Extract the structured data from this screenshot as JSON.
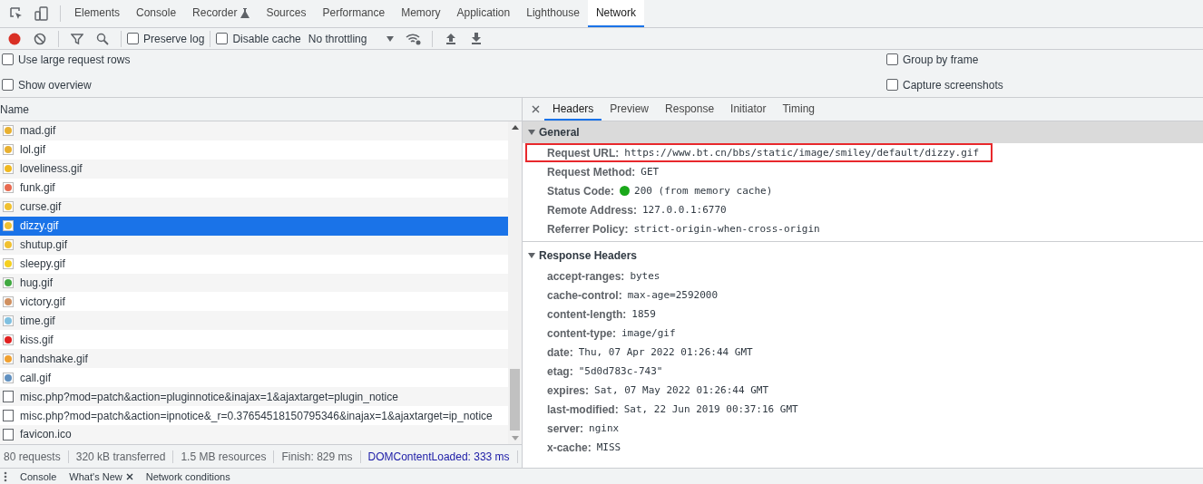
{
  "main_tabs": [
    {
      "label": "Elements",
      "selected": false
    },
    {
      "label": "Console",
      "selected": false
    },
    {
      "label": "Recorder",
      "selected": false,
      "kind": "experimental"
    },
    {
      "label": "Sources",
      "selected": false
    },
    {
      "label": "Performance",
      "selected": false
    },
    {
      "label": "Memory",
      "selected": false
    },
    {
      "label": "Application",
      "selected": false
    },
    {
      "label": "Lighthouse",
      "selected": false
    },
    {
      "label": "Network",
      "selected": true
    }
  ],
  "toolbar": {
    "recording": true,
    "preserve_log": {
      "label": "Preserve log",
      "checked": false
    },
    "disable_cache": {
      "label": "Disable cache",
      "checked": false
    },
    "throttling": "No throttling"
  },
  "settings_left": [
    {
      "label": "Use large request rows",
      "checked": false
    },
    {
      "label": "Show overview",
      "checked": false
    }
  ],
  "settings_right": [
    {
      "label": "Group by frame",
      "checked": false
    },
    {
      "label": "Capture screenshots",
      "checked": false
    }
  ],
  "requests": {
    "column": "Name",
    "rows": [
      {
        "name": "mad.gif",
        "kind": "image",
        "color": "#e8b030",
        "selected": false
      },
      {
        "name": "lol.gif",
        "kind": "image",
        "color": "#e8b030",
        "selected": false
      },
      {
        "name": "loveliness.gif",
        "kind": "image",
        "color": "#f0b820",
        "selected": false
      },
      {
        "name": "funk.gif",
        "kind": "image",
        "color": "#e86a50",
        "selected": false
      },
      {
        "name": "curse.gif",
        "kind": "image",
        "color": "#f0c030",
        "selected": false
      },
      {
        "name": "dizzy.gif",
        "kind": "image",
        "color": "#f0c030",
        "selected": true
      },
      {
        "name": "shutup.gif",
        "kind": "image",
        "color": "#f0c030",
        "selected": false
      },
      {
        "name": "sleepy.gif",
        "kind": "image",
        "color": "#f5d020",
        "selected": false
      },
      {
        "name": "hug.gif",
        "kind": "image",
        "color": "#40a840",
        "selected": false
      },
      {
        "name": "victory.gif",
        "kind": "image",
        "color": "#d09060",
        "selected": false
      },
      {
        "name": "time.gif",
        "kind": "image",
        "color": "#80c0e0",
        "selected": false
      },
      {
        "name": "kiss.gif",
        "kind": "image",
        "color": "#e02020",
        "selected": false
      },
      {
        "name": "handshake.gif",
        "kind": "image",
        "color": "#f0a030",
        "selected": false
      },
      {
        "name": "call.gif",
        "kind": "image",
        "color": "#6090c0",
        "selected": false
      },
      {
        "name": "misc.php?mod=patch&action=pluginnotice&inajax=1&ajaxtarget=plugin_notice",
        "kind": "document",
        "selected": false
      },
      {
        "name": "misc.php?mod=patch&action=ipnotice&_r=0.37654518150795346&inajax=1&ajaxtarget=ip_notice",
        "kind": "document",
        "selected": false
      },
      {
        "name": "favicon.ico",
        "kind": "document",
        "selected": false
      }
    ]
  },
  "status_bar": [
    {
      "text": "80 requests",
      "kind": "plain"
    },
    {
      "text": "320 kB transferred",
      "kind": "plain"
    },
    {
      "text": "1.5 MB resources",
      "kind": "plain"
    },
    {
      "text": "Finish: 829 ms",
      "kind": "plain"
    },
    {
      "text": "DOMContentLoaded: 333 ms",
      "kind": "dom"
    }
  ],
  "detail_tabs": [
    {
      "label": "Headers",
      "selected": true
    },
    {
      "label": "Preview",
      "selected": false
    },
    {
      "label": "Response",
      "selected": false
    },
    {
      "label": "Initiator",
      "selected": false
    },
    {
      "label": "Timing",
      "selected": false
    }
  ],
  "general": {
    "title": "General",
    "expanded": true,
    "rows": [
      {
        "key": "Request URL:",
        "value": "https://www.bt.cn/bbs/static/image/smiley/default/dizzy.gif",
        "highlighted": true
      },
      {
        "key": "Request Method:",
        "value": "GET",
        "highlighted": false
      },
      {
        "key": "Status Code:",
        "value": "200  (from memory cache)",
        "highlighted": false,
        "kind": "status",
        "color": "#1aa81a"
      },
      {
        "key": "Remote Address:",
        "value": "127.0.0.1:6770",
        "highlighted": false
      },
      {
        "key": "Referrer Policy:",
        "value": "strict-origin-when-cross-origin",
        "highlighted": false
      }
    ]
  },
  "response_headers": {
    "title": "Response Headers",
    "expanded": true,
    "rows": [
      {
        "key": "accept-ranges:",
        "value": "bytes"
      },
      {
        "key": "cache-control:",
        "value": "max-age=2592000"
      },
      {
        "key": "content-length:",
        "value": "1859"
      },
      {
        "key": "content-type:",
        "value": "image/gif"
      },
      {
        "key": "date:",
        "value": "Thu, 07 Apr 2022 01:26:44 GMT"
      },
      {
        "key": "etag:",
        "value": "\"5d0d783c-743\""
      },
      {
        "key": "expires:",
        "value": "Sat, 07 May 2022 01:26:44 GMT"
      },
      {
        "key": "last-modified:",
        "value": "Sat, 22 Jun 2019 00:37:16 GMT"
      },
      {
        "key": "server:",
        "value": "nginx"
      },
      {
        "key": "x-cache:",
        "value": "MISS"
      }
    ]
  },
  "drawer_tabs": [
    {
      "label": "Console",
      "closable": false
    },
    {
      "label": "What's New",
      "closable": true
    },
    {
      "label": "Network conditions",
      "closable": false
    }
  ]
}
